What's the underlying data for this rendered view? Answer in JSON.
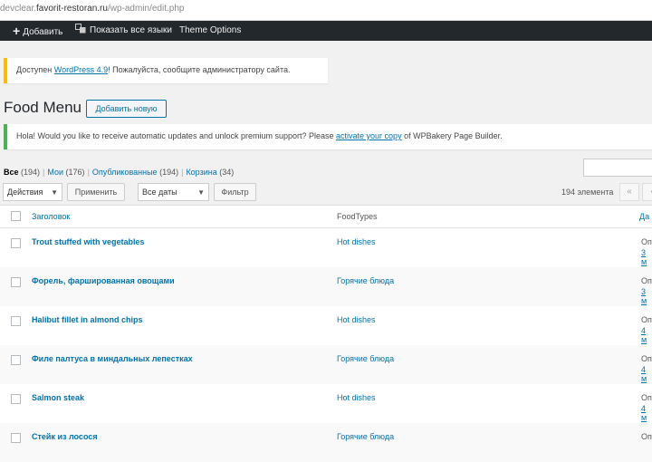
{
  "browser": {
    "url_prefix": "devclear.",
    "url_host": "favorit-restoran.ru",
    "url_path": "/wp-admin/edit.php"
  },
  "adminbar": {
    "add_new": "Добавить",
    "show_languages": "Показать все языки",
    "theme_options": "Theme Options"
  },
  "update_notice": {
    "before": "Доступен ",
    "link": "WordPress 4.9",
    "after": "! Пожалуйста, сообщите администратору сайта."
  },
  "page": {
    "title": "Food Menu",
    "add_new_button": "Добавить новую"
  },
  "wpbakery_notice": {
    "before": "Hola! Would you like to receive automatic updates and unlock premium support? Please ",
    "link": "activate your copy",
    "after": " of WPBakery Page Builder."
  },
  "subsubsub": [
    {
      "label": "Все",
      "count": "(194)"
    },
    {
      "label": "Мои",
      "count": "(176)"
    },
    {
      "label": "Опубликованные",
      "count": "(194)"
    },
    {
      "label": "Корзина",
      "count": "(34)"
    }
  ],
  "bulk": {
    "actions": "Действия",
    "apply": "Применить",
    "dates": "Все даты",
    "filter": "Фильтр"
  },
  "pagination": {
    "count": "194 элемента",
    "first": "«",
    "prev": "‹"
  },
  "table": {
    "headers": {
      "title": "Заголовок",
      "types": "FoodTypes",
      "date": "Да"
    },
    "rows": [
      {
        "title": "Trout stuffed with vegetables",
        "type": "Hot dishes",
        "date_status": "Оп",
        "date": "3 м"
      },
      {
        "title": "Форель, фаршированная овощами",
        "type": "Горячие блюда",
        "date_status": "Оп",
        "date": "3 м"
      },
      {
        "title": "Halibut fillet in almond chips",
        "type": "Hot dishes",
        "date_status": "Оп",
        "date": "4 м"
      },
      {
        "title": "Филе палтуса в миндальных лепестках",
        "type": "Горячие блюда",
        "date_status": "Оп",
        "date": "4 м"
      },
      {
        "title": "Salmon steak",
        "type": "Hot dishes",
        "date_status": "Оп",
        "date": "4 м"
      },
      {
        "title": "Стейк из лосося",
        "type": "Горячие блюда",
        "date_status": "Оп",
        "date": ""
      }
    ]
  },
  "colors": {
    "adminbar": "#23282d",
    "link": "#0073aa",
    "update_border": "#ffb900",
    "wpbakery_border": "#46b450"
  }
}
